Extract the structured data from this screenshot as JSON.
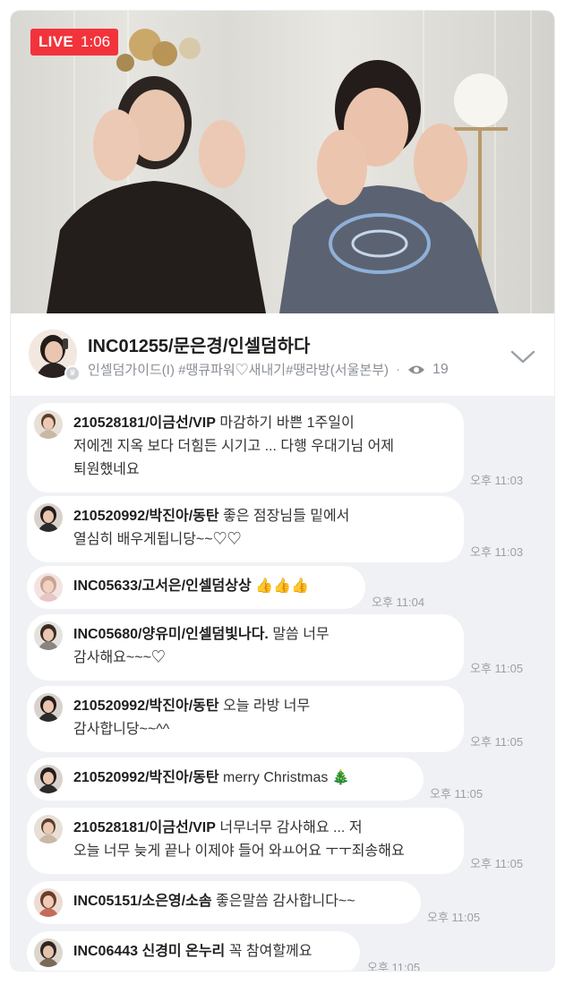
{
  "live": {
    "label": "LIVE",
    "elapsed": "1:06"
  },
  "host": {
    "name": "INC01255/문은경/인셀덤하다",
    "tags": "인셀덤가이드(I) #땡큐파워♡새내기#땡라방(서울본부)",
    "viewers": "19"
  },
  "colors": {
    "live_red": "#f2333b",
    "chat_bg": "#f0f1f4",
    "bubble_bg": "#ffffff"
  },
  "icons": {
    "viewers": "eye-icon",
    "expand": "chevron-down-icon",
    "host_badge": "crown-icon"
  },
  "messages": [
    {
      "author": "210528181/이금선/VIP",
      "lines": [
        "마감하기 바쁜 1주일이",
        "저에겐 지옥 보다 더힘든 시기고 ... 다행 우대기님 어제",
        "퇴원했네요"
      ],
      "time": "오후 11:03"
    },
    {
      "author": "210520992/박진아/동탄",
      "lines": [
        "좋은 점장님들 밑에서",
        "열심히 배우게됩니당~~♡♡"
      ],
      "time": "오후 11:03"
    },
    {
      "author": "INC05633/고서은/인셀덤상상",
      "lines": [
        "👍👍👍"
      ],
      "time": "오후 11:04"
    },
    {
      "author": "INC05680/양유미/인셀덤빛나다.",
      "lines": [
        "말씀 너무",
        "감사해요~~~♡"
      ],
      "time": "오후 11:05"
    },
    {
      "author": "210520992/박진아/동탄",
      "lines": [
        "오늘 라방 너무",
        "감사합니당~~^^"
      ],
      "time": "오후 11:05"
    },
    {
      "author": "210520992/박진아/동탄",
      "lines": [
        "merry Christmas 🎄"
      ],
      "time": "오후 11:05"
    },
    {
      "author": "210528181/이금선/VIP",
      "lines": [
        "너무너무 감사해요 ... 저",
        "오늘 너무 늦게 끝나 이제야 들어 와ㅛ어요 ㅜㅜ죄송해요"
      ],
      "time": "오후 11:05"
    },
    {
      "author": "INC05151/소은영/소솜",
      "lines": [
        "좋은말씀 감사합니다~~"
      ],
      "time": "오후 11:05"
    },
    {
      "author": "INC06443 신경미 온누리",
      "lines": [
        "꼭 참여할께요"
      ],
      "time": "오후 11:05"
    }
  ]
}
